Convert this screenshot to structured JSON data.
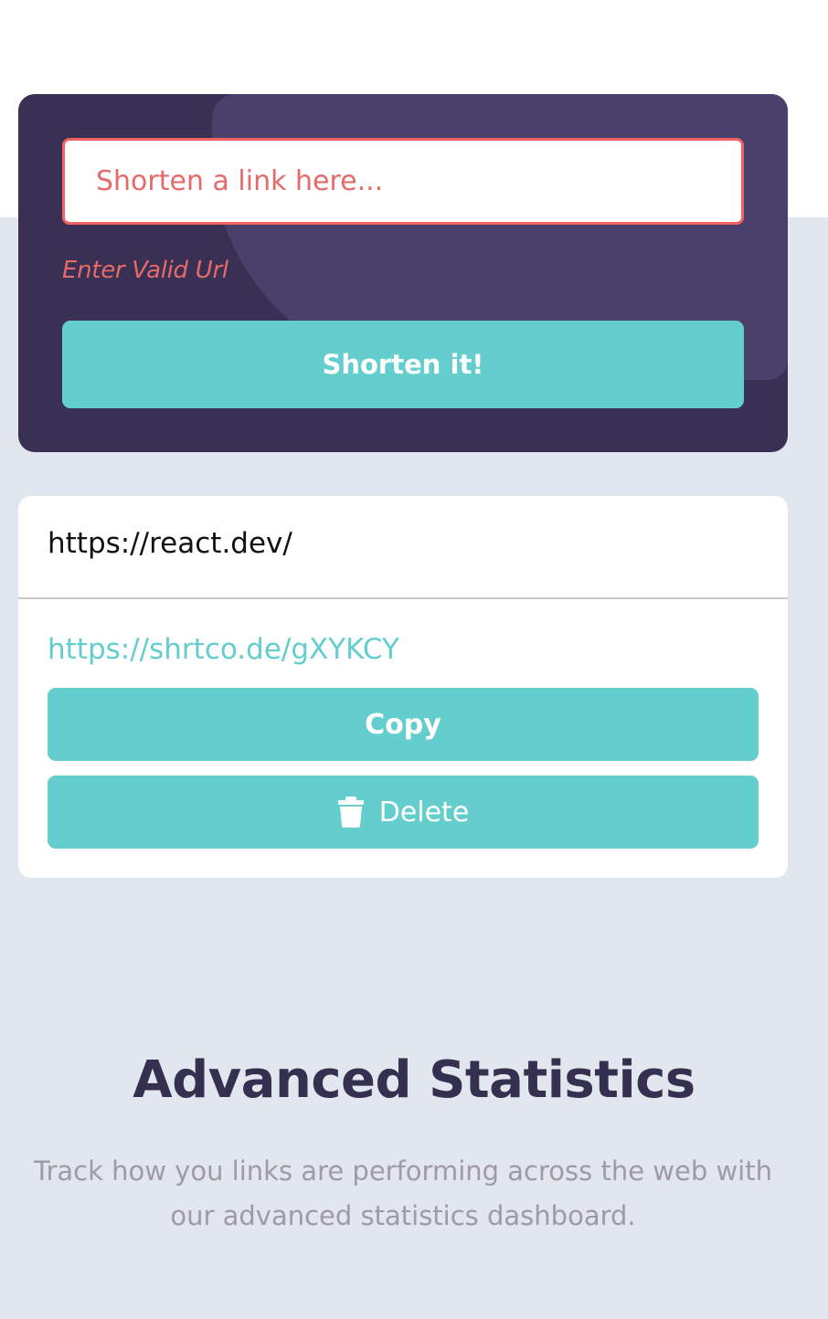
{
  "shortener": {
    "input_placeholder": "Shorten a link here...",
    "input_value": "",
    "error_text": "Enter Valid Url",
    "button_label": "Shorten it!"
  },
  "result": {
    "original_url": "https://react.dev/",
    "short_url": "https://shrtco.de/gXYKCY",
    "copy_label": "Copy",
    "delete_label": "Delete",
    "delete_icon": "trash-icon"
  },
  "stats": {
    "title": "Advanced Statistics",
    "description": "Track how you links are performing across the web with our advanced statistics dashboard."
  },
  "colors": {
    "dark_violet": "#3a3054",
    "cyan": "#64cdcd",
    "red_error": "#f46262",
    "page_bg": "#e2e6ee"
  }
}
